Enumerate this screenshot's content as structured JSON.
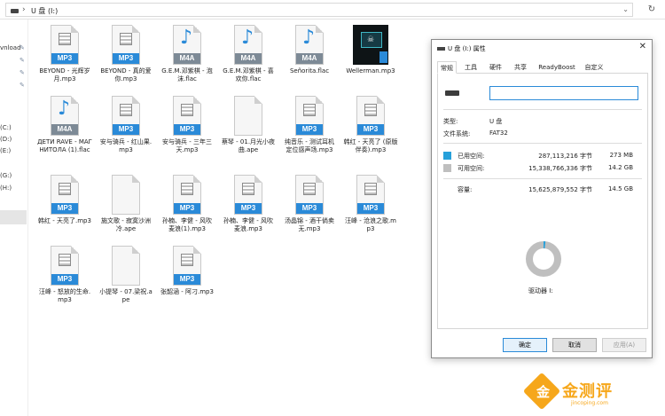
{
  "address_bar": {
    "path": "U 盘 (I:)"
  },
  "nav": {
    "items": [
      {
        "label": "vnload",
        "pinned": true
      },
      {
        "label": "",
        "pinned": true
      },
      {
        "label": "",
        "pinned": true
      },
      {
        "label": "",
        "pinned": true
      },
      {
        "label": "(C:)",
        "pinned": false
      },
      {
        "label": "(D:)",
        "pinned": false
      },
      {
        "label": "(E:)",
        "pinned": false
      },
      {
        "label": "(G:)",
        "pinned": false
      },
      {
        "label": "(H:)",
        "pinned": false
      }
    ]
  },
  "files": [
    {
      "name": "BEYOND - 光辉岁月.mp3",
      "type": "MP3"
    },
    {
      "name": "BEYOND - 真的爱你.mp3",
      "type": "MP3"
    },
    {
      "name": "G.E.M.邓紫棋 - 泡沫.flac",
      "type": "M4A"
    },
    {
      "name": "G.E.M.邓紫棋 - 喜欢你.flac",
      "type": "M4A"
    },
    {
      "name": "Señorita.flac",
      "type": "M4A"
    },
    {
      "name": "Wellerman.mp3",
      "type": "thumb"
    },
    {
      "name": "ДЕТИ RAVE - МАГНИТОЛА (1).flac",
      "type": "M4A"
    },
    {
      "name": "安与骑兵 - 红山果.mp3",
      "type": "MP3"
    },
    {
      "name": "安与骑兵 - 三年三天.mp3",
      "type": "MP3"
    },
    {
      "name": "蔡琴 - 01.月光小夜曲.ape",
      "type": "blank"
    },
    {
      "name": "纯音乐 - 测试耳机定位感声场.mp3",
      "type": "MP3"
    },
    {
      "name": "韩红 - 天亮了 (原版伴奏).mp3",
      "type": "MP3"
    },
    {
      "name": "韩红 - 天亮了.mp3",
      "type": "MP3"
    },
    {
      "name": "施文歌 - 寂寞沙洲冷.ape",
      "type": "blank"
    },
    {
      "name": "孙楠、李健 - 风吹麦浪(1).mp3",
      "type": "MP3"
    },
    {
      "name": "孙楠、李健 - 风吹麦浪.mp3",
      "type": "MP3"
    },
    {
      "name": "汤晶锦 - 酒干倘卖无.mp3",
      "type": "MP3"
    },
    {
      "name": "汪峰 - 沧浪之歌.mp3",
      "type": "MP3"
    },
    {
      "name": "汪峰 - 怒放的生命.mp3",
      "type": "MP3"
    },
    {
      "name": "小提琴 - 07.梁祝.ape",
      "type": "blank"
    },
    {
      "name": "张韶涵 - 阿刁.mp3",
      "type": "MP3"
    }
  ],
  "dialog": {
    "title": "U 盘 (I:) 属性",
    "tabs": [
      "常规",
      "工具",
      "硬件",
      "共享",
      "ReadyBoost",
      "自定义"
    ],
    "active_tab": "常规",
    "drive_name_value": "",
    "type_label": "类型:",
    "type_value": "U 盘",
    "fs_label": "文件系统:",
    "fs_value": "FAT32",
    "used_label": "已用空间:",
    "used_bytes": "287,113,216 字节",
    "used_size": "273 MB",
    "free_label": "可用空间:",
    "free_bytes": "15,338,766,336 字节",
    "free_size": "14.2 GB",
    "capacity_label": "容量:",
    "capacity_bytes": "15,625,879,552 字节",
    "capacity_size": "14.5 GB",
    "used_fraction": 0.018,
    "drive_label": "驱动器 I:",
    "ok_label": "确定",
    "cancel_label": "取消",
    "apply_label": "应用(A)",
    "colors": {
      "used": "#26a0da",
      "free": "#bfbfbf",
      "accent": "#2a8ad8"
    }
  },
  "watermark": {
    "badge": "金",
    "text": "金测评",
    "url": "jincoping.com"
  }
}
